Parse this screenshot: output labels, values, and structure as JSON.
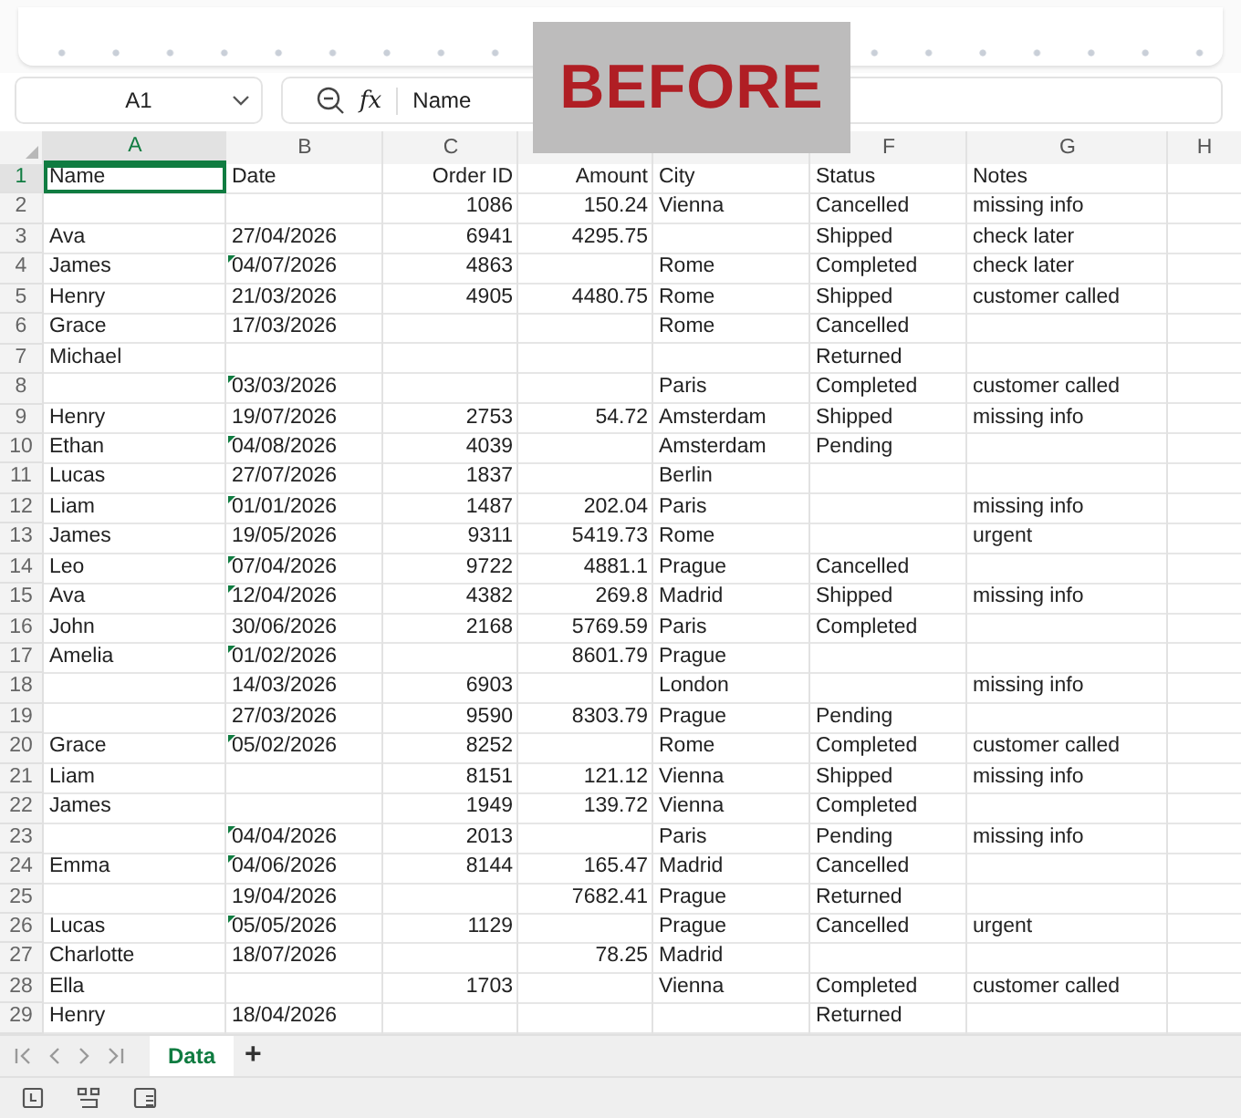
{
  "formula_bar": {
    "name_box": "A1",
    "fx": "fx",
    "formula": "Name"
  },
  "overlay_label": "BEFORE",
  "columns": [
    {
      "label": "A",
      "selected": true
    },
    {
      "label": "B",
      "selected": false
    },
    {
      "label": "C",
      "selected": false
    },
    {},
    {},
    {
      "label": "F",
      "selected": false
    },
    {
      "label": "G",
      "selected": false
    },
    {
      "label": "H",
      "selected": false
    }
  ],
  "rows": [
    {
      "number": "1",
      "selected": true,
      "name": "Name",
      "date": "Date",
      "order_id": "Order ID",
      "amount": "Amount",
      "city": "City",
      "status": "Status",
      "notes": "Notes",
      "date_flag": false
    },
    {
      "number": "2",
      "selected": false,
      "order_id": "1086",
      "amount": "150.24",
      "city": "Vienna",
      "status": "Cancelled",
      "notes": "missing info",
      "date_flag": false
    },
    {
      "number": "3",
      "selected": false,
      "name": "Ava",
      "date": "27/04/2026",
      "order_id": "6941",
      "amount": "4295.75",
      "status": "Shipped",
      "notes": "check later",
      "date_flag": false
    },
    {
      "number": "4",
      "selected": false,
      "name": "James",
      "date": "04/07/2026",
      "order_id": "4863",
      "city": "Rome",
      "status": "Completed",
      "notes": "check later",
      "date_flag": true
    },
    {
      "number": "5",
      "selected": false,
      "name": "Henry",
      "date": "21/03/2026",
      "order_id": "4905",
      "amount": "4480.75",
      "city": "Rome",
      "status": "Shipped",
      "notes": "customer called",
      "date_flag": false
    },
    {
      "number": "6",
      "selected": false,
      "name": "Grace",
      "date": "17/03/2026",
      "city": "Rome",
      "status": "Cancelled",
      "date_flag": false
    },
    {
      "number": "7",
      "selected": false,
      "name": "Michael",
      "status": "Returned",
      "date_flag": false
    },
    {
      "number": "8",
      "selected": false,
      "date": "03/03/2026",
      "city": "Paris",
      "status": "Completed",
      "notes": "customer called",
      "date_flag": true
    },
    {
      "number": "9",
      "selected": false,
      "name": "Henry",
      "date": "19/07/2026",
      "order_id": "2753",
      "amount": "54.72",
      "city": "Amsterdam",
      "status": "Shipped",
      "notes": "missing info",
      "date_flag": false
    },
    {
      "number": "10",
      "selected": false,
      "name": "Ethan",
      "date": "04/08/2026",
      "order_id": "4039",
      "city": "Amsterdam",
      "status": "Pending",
      "date_flag": true
    },
    {
      "number": "11",
      "selected": false,
      "name": "Lucas",
      "date": "27/07/2026",
      "order_id": "1837",
      "city": "Berlin",
      "date_flag": false
    },
    {
      "number": "12",
      "selected": false,
      "name": "Liam",
      "date": "01/01/2026",
      "order_id": "1487",
      "amount": "202.04",
      "city": "Paris",
      "notes": "missing info",
      "date_flag": true
    },
    {
      "number": "13",
      "selected": false,
      "name": "James",
      "date": "19/05/2026",
      "order_id": "9311",
      "amount": "5419.73",
      "city": "Rome",
      "notes": "urgent",
      "date_flag": false
    },
    {
      "number": "14",
      "selected": false,
      "name": "Leo",
      "date": "07/04/2026",
      "order_id": "9722",
      "amount": "4881.1",
      "city": "Prague",
      "status": "Cancelled",
      "date_flag": true
    },
    {
      "number": "15",
      "selected": false,
      "name": "Ava",
      "date": "12/04/2026",
      "order_id": "4382",
      "amount": "269.8",
      "city": "Madrid",
      "status": "Shipped",
      "notes": "missing info",
      "date_flag": true
    },
    {
      "number": "16",
      "selected": false,
      "name": "John",
      "date": "30/06/2026",
      "order_id": "2168",
      "amount": "5769.59",
      "city": "Paris",
      "status": "Completed",
      "date_flag": false
    },
    {
      "number": "17",
      "selected": false,
      "name": "Amelia",
      "date": "01/02/2026",
      "amount": "8601.79",
      "city": "Prague",
      "date_flag": true
    },
    {
      "number": "18",
      "selected": false,
      "date": "14/03/2026",
      "order_id": "6903",
      "city": "London",
      "notes": "missing info",
      "date_flag": false
    },
    {
      "number": "19",
      "selected": false,
      "date": "27/03/2026",
      "order_id": "9590",
      "amount": "8303.79",
      "city": "Prague",
      "status": "Pending",
      "date_flag": false
    },
    {
      "number": "20",
      "selected": false,
      "name": "Grace",
      "date": "05/02/2026",
      "order_id": "8252",
      "city": "Rome",
      "status": "Completed",
      "notes": "customer called",
      "date_flag": true
    },
    {
      "number": "21",
      "selected": false,
      "name": "Liam",
      "order_id": "8151",
      "amount": "121.12",
      "city": "Vienna",
      "status": "Shipped",
      "notes": "missing info",
      "date_flag": false
    },
    {
      "number": "22",
      "selected": false,
      "name": "James",
      "order_id": "1949",
      "amount": "139.72",
      "city": "Vienna",
      "status": "Completed",
      "date_flag": false
    },
    {
      "number": "23",
      "selected": false,
      "date": "04/04/2026",
      "order_id": "2013",
      "city": "Paris",
      "status": "Pending",
      "notes": "missing info",
      "date_flag": true
    },
    {
      "number": "24",
      "selected": false,
      "name": "Emma",
      "date": "04/06/2026",
      "order_id": "8144",
      "amount": "165.47",
      "city": "Madrid",
      "status": "Cancelled",
      "date_flag": true
    },
    {
      "number": "25",
      "selected": false,
      "date": "19/04/2026",
      "amount": "7682.41",
      "city": "Prague",
      "status": "Returned",
      "date_flag": false
    },
    {
      "number": "26",
      "selected": false,
      "name": "Lucas",
      "date": "05/05/2026",
      "order_id": "1129",
      "city": "Prague",
      "status": "Cancelled",
      "notes": "urgent",
      "date_flag": true
    },
    {
      "number": "27",
      "selected": false,
      "name": "Charlotte",
      "date": "18/07/2026",
      "amount": "78.25",
      "city": "Madrid",
      "date_flag": false
    },
    {
      "number": "28",
      "selected": false,
      "name": "Ella",
      "order_id": "1703",
      "city": "Vienna",
      "status": "Completed",
      "notes": "customer called",
      "date_flag": false
    },
    {
      "number": "29",
      "selected": false,
      "name": "Henry",
      "date": "18/04/2026",
      "status": "Returned",
      "date_flag": false
    }
  ],
  "sheet_tabs": [
    {
      "label": "Data",
      "selected": true
    }
  ],
  "add_sheet": "+"
}
